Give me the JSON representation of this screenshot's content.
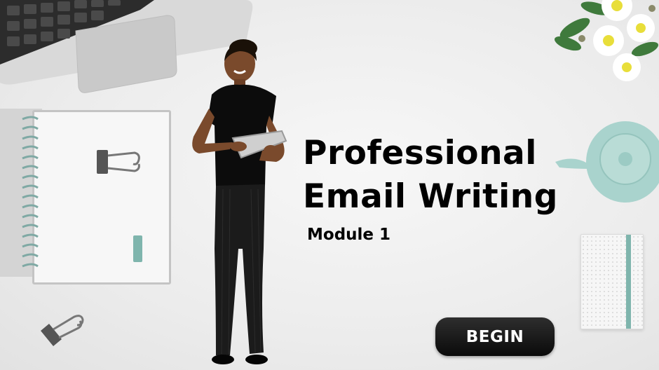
{
  "slide": {
    "title_line1": "Professional",
    "title_line2": "Email Writing",
    "subtitle": "Module 1",
    "begin_label": "BEGIN"
  },
  "colors": {
    "background": "#ededed",
    "button_bg": "#1a1a1a",
    "button_text": "#ffffff",
    "teapot": "#a9d3cd",
    "notebook_spine": "#7fb5ad"
  },
  "icons": [
    "laptop-icon",
    "notebook-icon",
    "binder-clip-icon",
    "eraser-icon",
    "flowers-icon",
    "teapot-icon",
    "small-notebook-icon",
    "person-illustration"
  ]
}
